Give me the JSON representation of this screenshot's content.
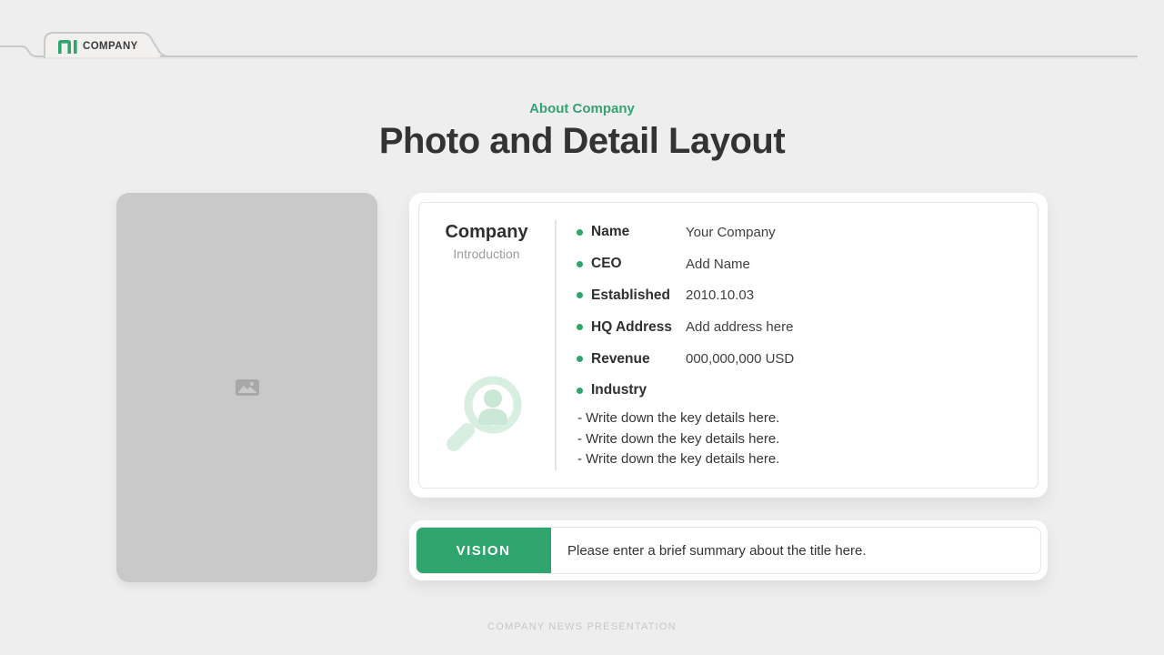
{
  "tab": {
    "company": "COMPANY"
  },
  "header": {
    "eyebrow": "About Company",
    "title": "Photo and Detail Layout"
  },
  "detail_card": {
    "left_title": "Company",
    "left_subtitle": "Introduction",
    "fields": [
      {
        "label": "Name",
        "value": "Your Company"
      },
      {
        "label": "CEO",
        "value": "Add Name"
      },
      {
        "label": "Established",
        "value": "2010.10.03"
      },
      {
        "label": "HQ Address",
        "value": "Add address here"
      },
      {
        "label": "Revenue",
        "value": "000,000,000 USD"
      },
      {
        "label": "Industry",
        "value": ""
      }
    ],
    "notes": [
      "- Write down the key details here.",
      "- Write down the key details here.",
      "- Write down the key details here."
    ]
  },
  "vision": {
    "label": "VISION",
    "summary": "Please enter a brief summary about the title here."
  },
  "footer": {
    "text": "COMPANY NEWS PRESENTATION"
  },
  "icons": {
    "logo": "pi-bar-logo-icon",
    "photo_placeholder": "image-placeholder-icon",
    "card_watermark": "magnifier-person-icon"
  },
  "colors": {
    "accent_green": "#2fa46d",
    "accent_green_light": "#d7eee0",
    "background": "#efeeee",
    "rule_gray": "#c9c9c9",
    "placeholder_gray": "#c9c9c9"
  }
}
